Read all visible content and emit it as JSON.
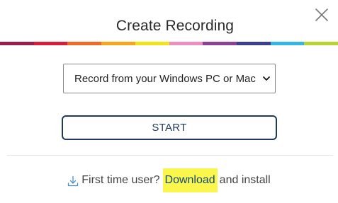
{
  "dialog": {
    "title": "Create Recording",
    "close_icon": "close-icon"
  },
  "color_strip": {
    "colors": [
      "#9b1d4b",
      "#d81e3a",
      "#f06a27",
      "#f7a51d",
      "#f4e31a",
      "#ee8fc1",
      "#8e3f98",
      "#3a3f8f",
      "#34b7e6",
      "#b9d534"
    ]
  },
  "recording_source": {
    "selected": "Record from your Windows PC or Mac"
  },
  "start_button": {
    "label": "START"
  },
  "footer": {
    "icon": "download-icon",
    "prefix": "First time user?",
    "link_label": "Download",
    "suffix": "and install"
  },
  "colors": {
    "accent": "#1f3b5c",
    "highlight": "#fbf64b"
  }
}
